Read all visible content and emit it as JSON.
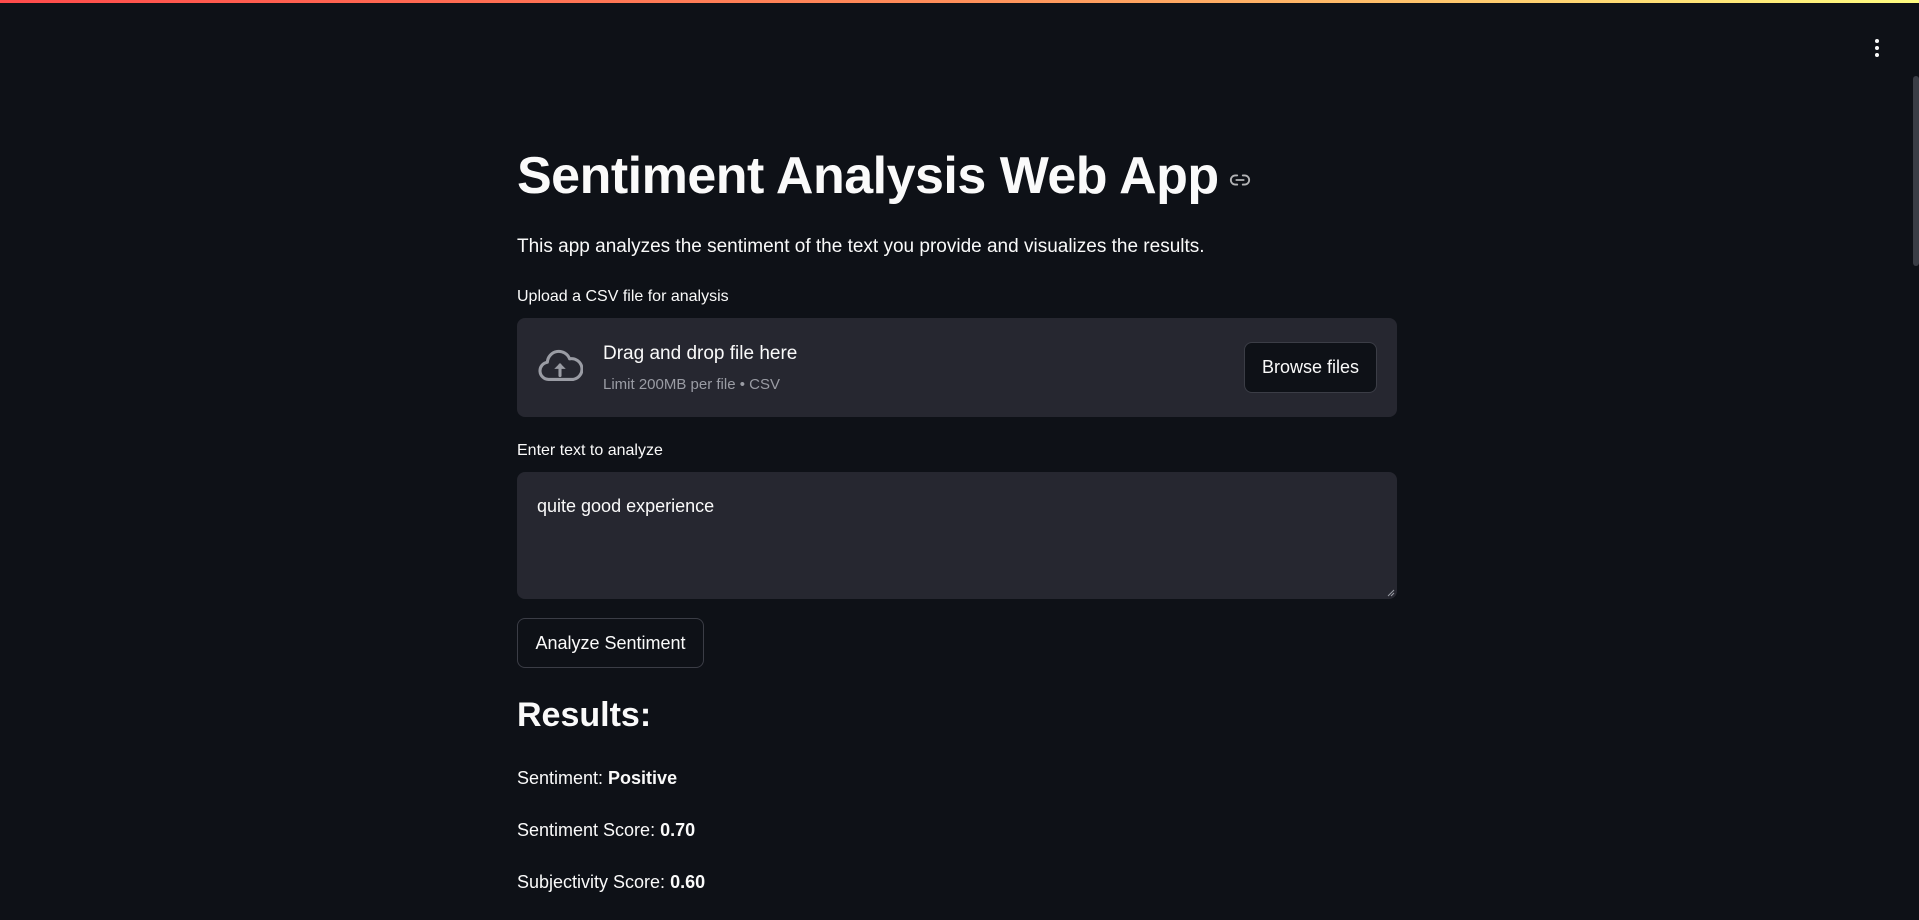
{
  "header": {
    "menu_icon": "kebab-vertical-icon"
  },
  "main": {
    "title": "Sentiment Analysis Web App",
    "title_anchor_icon": "link-icon",
    "subtitle": "This app analyzes the sentiment of the text you provide and visualizes the results."
  },
  "uploader": {
    "label": "Upload a CSV file for analysis",
    "icon": "cloud-upload-icon",
    "drag_text": "Drag and drop file here",
    "limit_text": "Limit 200MB per file • CSV",
    "browse_label": "Browse files"
  },
  "text_input": {
    "label": "Enter text to analyze",
    "value": "quite good experience"
  },
  "analyze_button": {
    "label": "Analyze Sentiment"
  },
  "results": {
    "heading": "Results:",
    "sentiment_label": "Sentiment: ",
    "sentiment_value": "Positive",
    "score_label": "Sentiment Score: ",
    "score_value": "0.70",
    "subjectivity_label": "Subjectivity Score: ",
    "subjectivity_value": "0.60"
  },
  "colors": {
    "background": "#0e1117",
    "panel": "#262730",
    "text": "#fafafa",
    "muted": "#9a9ca4"
  }
}
